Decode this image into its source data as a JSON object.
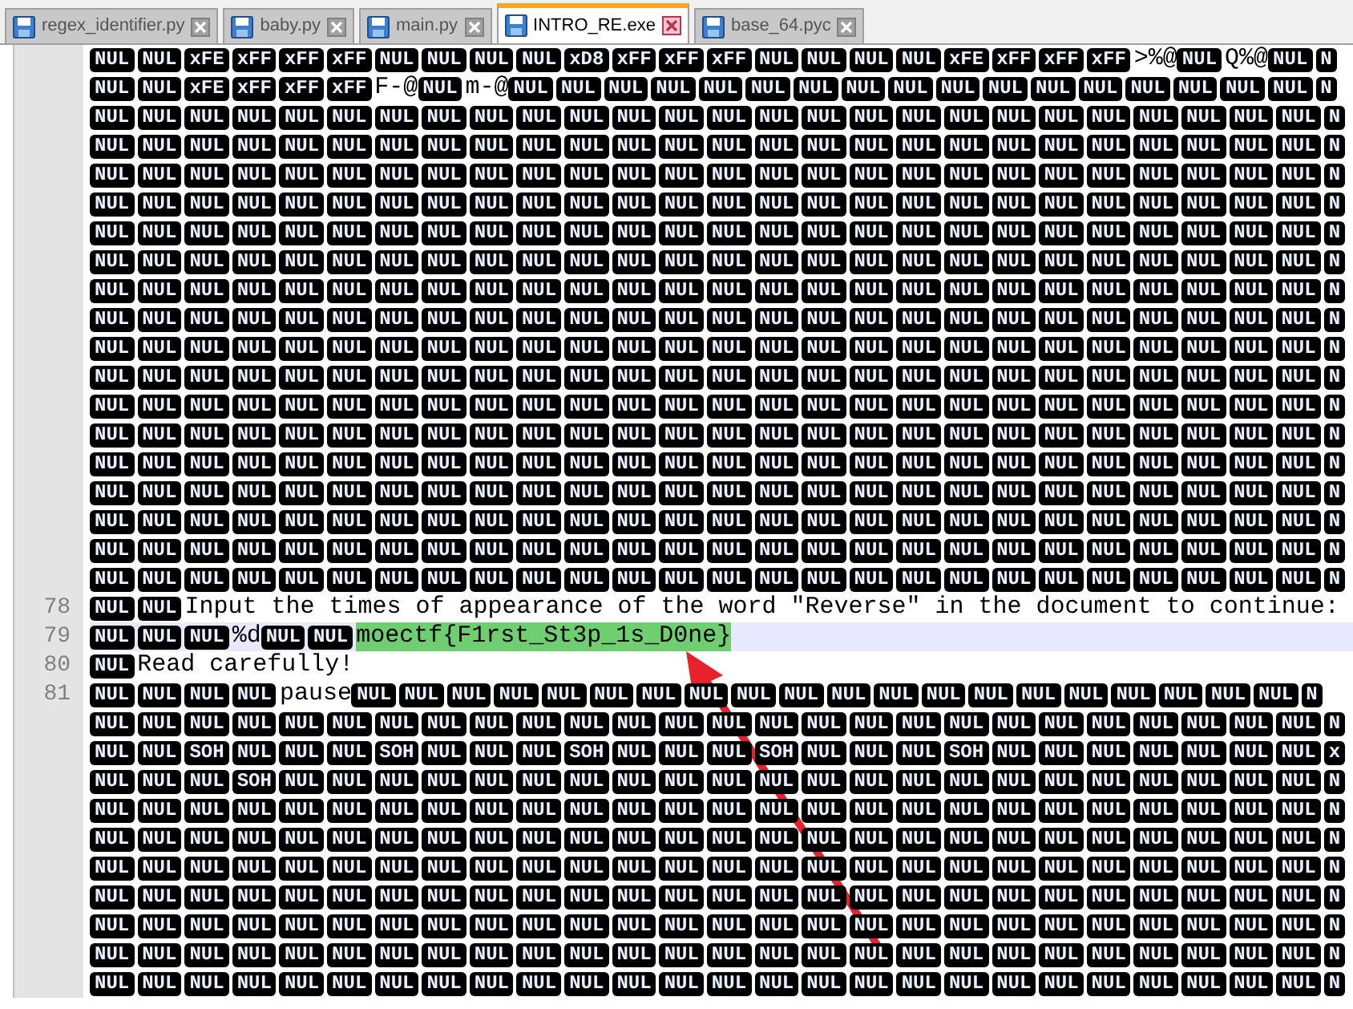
{
  "tabs": [
    {
      "label": "regex_identifier.py",
      "selected": false
    },
    {
      "label": "baby.py",
      "selected": false
    },
    {
      "label": "main.py",
      "selected": false
    },
    {
      "label": "INTRO_RE.exe",
      "selected": true
    },
    {
      "label": "base_64.pyc",
      "selected": false
    }
  ],
  "lines": [
    {
      "current": false,
      "runs": [
        {
          "kind": "ctrl",
          "texts": [
            "NUL",
            "NUL",
            "xFE",
            "xFF",
            "xFF",
            "xFF",
            "NUL",
            "NUL",
            "NUL",
            "NUL",
            "xD8",
            "xFF",
            "xFF",
            "xFF",
            "NUL",
            "NUL",
            "NUL",
            "NUL",
            "xFE",
            "xFF",
            "xFF",
            "xFF"
          ]
        },
        {
          "kind": "text",
          "text": ">%@",
          "highlighted": false
        },
        {
          "kind": "ctrl",
          "texts": [
            "NUL"
          ]
        },
        {
          "kind": "text",
          "text": "Q%@",
          "highlighted": false
        },
        {
          "kind": "ctrl",
          "texts": [
            "NUL",
            "N"
          ]
        }
      ]
    },
    {
      "current": false,
      "runs": [
        {
          "kind": "ctrl",
          "texts": [
            "NUL",
            "NUL",
            "xFE",
            "xFF",
            "xFF",
            "xFF"
          ]
        },
        {
          "kind": "text",
          "text": "F-@",
          "highlighted": false
        },
        {
          "kind": "ctrl",
          "texts": [
            "NUL"
          ]
        },
        {
          "kind": "text",
          "text": "m-@",
          "highlighted": false
        },
        {
          "kind": "ctrl",
          "texts": [
            "NUL",
            "NUL",
            "NUL",
            "NUL",
            "NUL",
            "NUL",
            "NUL",
            "NUL",
            "NUL",
            "NUL",
            "NUL",
            "NUL",
            "NUL",
            "NUL",
            "NUL",
            "NUL",
            "NUL",
            "N"
          ]
        }
      ]
    },
    {
      "current": false,
      "runs": [
        {
          "kind": "ctrl",
          "texts": [
            "NUL",
            "NUL",
            "NUL",
            "NUL",
            "NUL",
            "NUL",
            "NUL",
            "NUL",
            "NUL",
            "NUL",
            "NUL",
            "NUL",
            "NUL",
            "NUL",
            "NUL",
            "NUL",
            "NUL",
            "NUL",
            "NUL",
            "NUL",
            "NUL",
            "NUL",
            "NUL",
            "NUL",
            "NUL",
            "NUL",
            "N"
          ]
        }
      ]
    },
    {
      "current": false,
      "runs": [
        {
          "kind": "ctrl",
          "texts": [
            "NUL",
            "NUL",
            "NUL",
            "NUL",
            "NUL",
            "NUL",
            "NUL",
            "NUL",
            "NUL",
            "NUL",
            "NUL",
            "NUL",
            "NUL",
            "NUL",
            "NUL",
            "NUL",
            "NUL",
            "NUL",
            "NUL",
            "NUL",
            "NUL",
            "NUL",
            "NUL",
            "NUL",
            "NUL",
            "NUL",
            "N"
          ]
        }
      ]
    },
    {
      "current": false,
      "runs": [
        {
          "kind": "ctrl",
          "texts": [
            "NUL",
            "NUL",
            "NUL",
            "NUL",
            "NUL",
            "NUL",
            "NUL",
            "NUL",
            "NUL",
            "NUL",
            "NUL",
            "NUL",
            "NUL",
            "NUL",
            "NUL",
            "NUL",
            "NUL",
            "NUL",
            "NUL",
            "NUL",
            "NUL",
            "NUL",
            "NUL",
            "NUL",
            "NUL",
            "NUL",
            "N"
          ]
        }
      ]
    },
    {
      "current": false,
      "runs": [
        {
          "kind": "ctrl",
          "texts": [
            "NUL",
            "NUL",
            "NUL",
            "NUL",
            "NUL",
            "NUL",
            "NUL",
            "NUL",
            "NUL",
            "NUL",
            "NUL",
            "NUL",
            "NUL",
            "NUL",
            "NUL",
            "NUL",
            "NUL",
            "NUL",
            "NUL",
            "NUL",
            "NUL",
            "NUL",
            "NUL",
            "NUL",
            "NUL",
            "NUL",
            "N"
          ]
        }
      ]
    },
    {
      "current": false,
      "runs": [
        {
          "kind": "ctrl",
          "texts": [
            "NUL",
            "NUL",
            "NUL",
            "NUL",
            "NUL",
            "NUL",
            "NUL",
            "NUL",
            "NUL",
            "NUL",
            "NUL",
            "NUL",
            "NUL",
            "NUL",
            "NUL",
            "NUL",
            "NUL",
            "NUL",
            "NUL",
            "NUL",
            "NUL",
            "NUL",
            "NUL",
            "NUL",
            "NUL",
            "NUL",
            "N"
          ]
        }
      ]
    },
    {
      "current": false,
      "runs": [
        {
          "kind": "ctrl",
          "texts": [
            "NUL",
            "NUL",
            "NUL",
            "NUL",
            "NUL",
            "NUL",
            "NUL",
            "NUL",
            "NUL",
            "NUL",
            "NUL",
            "NUL",
            "NUL",
            "NUL",
            "NUL",
            "NUL",
            "NUL",
            "NUL",
            "NUL",
            "NUL",
            "NUL",
            "NUL",
            "NUL",
            "NUL",
            "NUL",
            "NUL",
            "N"
          ]
        }
      ]
    },
    {
      "current": false,
      "runs": [
        {
          "kind": "ctrl",
          "texts": [
            "NUL",
            "NUL",
            "NUL",
            "NUL",
            "NUL",
            "NUL",
            "NUL",
            "NUL",
            "NUL",
            "NUL",
            "NUL",
            "NUL",
            "NUL",
            "NUL",
            "NUL",
            "NUL",
            "NUL",
            "NUL",
            "NUL",
            "NUL",
            "NUL",
            "NUL",
            "NUL",
            "NUL",
            "NUL",
            "NUL",
            "N"
          ]
        }
      ]
    },
    {
      "current": false,
      "runs": [
        {
          "kind": "ctrl",
          "texts": [
            "NUL",
            "NUL",
            "NUL",
            "NUL",
            "NUL",
            "NUL",
            "NUL",
            "NUL",
            "NUL",
            "NUL",
            "NUL",
            "NUL",
            "NUL",
            "NUL",
            "NUL",
            "NUL",
            "NUL",
            "NUL",
            "NUL",
            "NUL",
            "NUL",
            "NUL",
            "NUL",
            "NUL",
            "NUL",
            "NUL",
            "N"
          ]
        }
      ]
    },
    {
      "current": false,
      "runs": [
        {
          "kind": "ctrl",
          "texts": [
            "NUL",
            "NUL",
            "NUL",
            "NUL",
            "NUL",
            "NUL",
            "NUL",
            "NUL",
            "NUL",
            "NUL",
            "NUL",
            "NUL",
            "NUL",
            "NUL",
            "NUL",
            "NUL",
            "NUL",
            "NUL",
            "NUL",
            "NUL",
            "NUL",
            "NUL",
            "NUL",
            "NUL",
            "NUL",
            "NUL",
            "N"
          ]
        }
      ]
    },
    {
      "current": false,
      "runs": [
        {
          "kind": "ctrl",
          "texts": [
            "NUL",
            "NUL",
            "NUL",
            "NUL",
            "NUL",
            "NUL",
            "NUL",
            "NUL",
            "NUL",
            "NUL",
            "NUL",
            "NUL",
            "NUL",
            "NUL",
            "NUL",
            "NUL",
            "NUL",
            "NUL",
            "NUL",
            "NUL",
            "NUL",
            "NUL",
            "NUL",
            "NUL",
            "NUL",
            "NUL",
            "N"
          ]
        }
      ]
    },
    {
      "current": false,
      "runs": [
        {
          "kind": "ctrl",
          "texts": [
            "NUL",
            "NUL",
            "NUL",
            "NUL",
            "NUL",
            "NUL",
            "NUL",
            "NUL",
            "NUL",
            "NUL",
            "NUL",
            "NUL",
            "NUL",
            "NUL",
            "NUL",
            "NUL",
            "NUL",
            "NUL",
            "NUL",
            "NUL",
            "NUL",
            "NUL",
            "NUL",
            "NUL",
            "NUL",
            "NUL",
            "N"
          ]
        }
      ]
    },
    {
      "current": false,
      "runs": [
        {
          "kind": "ctrl",
          "texts": [
            "NUL",
            "NUL",
            "NUL",
            "NUL",
            "NUL",
            "NUL",
            "NUL",
            "NUL",
            "NUL",
            "NUL",
            "NUL",
            "NUL",
            "NUL",
            "NUL",
            "NUL",
            "NUL",
            "NUL",
            "NUL",
            "NUL",
            "NUL",
            "NUL",
            "NUL",
            "NUL",
            "NUL",
            "NUL",
            "NUL",
            "N"
          ]
        }
      ]
    },
    {
      "current": false,
      "runs": [
        {
          "kind": "ctrl",
          "texts": [
            "NUL",
            "NUL",
            "NUL",
            "NUL",
            "NUL",
            "NUL",
            "NUL",
            "NUL",
            "NUL",
            "NUL",
            "NUL",
            "NUL",
            "NUL",
            "NUL",
            "NUL",
            "NUL",
            "NUL",
            "NUL",
            "NUL",
            "NUL",
            "NUL",
            "NUL",
            "NUL",
            "NUL",
            "NUL",
            "NUL",
            "N"
          ]
        }
      ]
    },
    {
      "current": false,
      "runs": [
        {
          "kind": "ctrl",
          "texts": [
            "NUL",
            "NUL",
            "NUL",
            "NUL",
            "NUL",
            "NUL",
            "NUL",
            "NUL",
            "NUL",
            "NUL",
            "NUL",
            "NUL",
            "NUL",
            "NUL",
            "NUL",
            "NUL",
            "NUL",
            "NUL",
            "NUL",
            "NUL",
            "NUL",
            "NUL",
            "NUL",
            "NUL",
            "NUL",
            "NUL",
            "N"
          ]
        }
      ]
    },
    {
      "current": false,
      "runs": [
        {
          "kind": "ctrl",
          "texts": [
            "NUL",
            "NUL",
            "NUL",
            "NUL",
            "NUL",
            "NUL",
            "NUL",
            "NUL",
            "NUL",
            "NUL",
            "NUL",
            "NUL",
            "NUL",
            "NUL",
            "NUL",
            "NUL",
            "NUL",
            "NUL",
            "NUL",
            "NUL",
            "NUL",
            "NUL",
            "NUL",
            "NUL",
            "NUL",
            "NUL",
            "N"
          ]
        }
      ]
    },
    {
      "current": false,
      "runs": [
        {
          "kind": "ctrl",
          "texts": [
            "NUL",
            "NUL",
            "NUL",
            "NUL",
            "NUL",
            "NUL",
            "NUL",
            "NUL",
            "NUL",
            "NUL",
            "NUL",
            "NUL",
            "NUL",
            "NUL",
            "NUL",
            "NUL",
            "NUL",
            "NUL",
            "NUL",
            "NUL",
            "NUL",
            "NUL",
            "NUL",
            "NUL",
            "NUL",
            "NUL",
            "N"
          ]
        }
      ]
    },
    {
      "current": false,
      "runs": [
        {
          "kind": "ctrl",
          "texts": [
            "NUL",
            "NUL",
            "NUL",
            "NUL",
            "NUL",
            "NUL",
            "NUL",
            "NUL",
            "NUL",
            "NUL",
            "NUL",
            "NUL",
            "NUL",
            "NUL",
            "NUL",
            "NUL",
            "NUL",
            "NUL",
            "NUL",
            "NUL",
            "NUL",
            "NUL",
            "NUL",
            "NUL",
            "NUL",
            "NUL",
            "N"
          ]
        }
      ]
    },
    {
      "number": "78",
      "current": false,
      "runs": [
        {
          "kind": "ctrl",
          "texts": [
            "NUL",
            "NUL"
          ]
        },
        {
          "kind": "text",
          "text": "Input the times of appearance of the word \"Reverse\" in the document to continue:",
          "highlighted": false
        }
      ]
    },
    {
      "number": "79",
      "current": true,
      "runs": [
        {
          "kind": "ctrl",
          "texts": [
            "NUL",
            "NUL",
            "NUL"
          ]
        },
        {
          "kind": "text",
          "text": "%d",
          "highlighted": false
        },
        {
          "kind": "ctrl",
          "texts": [
            "NUL",
            "NUL"
          ]
        },
        {
          "kind": "text",
          "text": "moectf{F1rst_St3p_1s_D0ne}",
          "highlighted": true
        }
      ]
    },
    {
      "number": "80",
      "current": false,
      "runs": [
        {
          "kind": "ctrl",
          "texts": [
            "NUL"
          ]
        },
        {
          "kind": "text",
          "text": "Read carefully!",
          "highlighted": false
        }
      ]
    },
    {
      "number": "81",
      "current": false,
      "runs": [
        {
          "kind": "ctrl",
          "texts": [
            "NUL",
            "NUL",
            "NUL",
            "NUL"
          ]
        },
        {
          "kind": "text",
          "text": "pause",
          "highlighted": false
        },
        {
          "kind": "ctrl",
          "texts": [
            "NUL",
            "NUL",
            "NUL",
            "NUL",
            "NUL",
            "NUL",
            "NUL",
            "NUL",
            "NUL",
            "NUL",
            "NUL",
            "NUL",
            "NUL",
            "NUL",
            "NUL",
            "NUL",
            "NUL",
            "NUL",
            "NUL",
            "NUL",
            "N"
          ]
        }
      ]
    },
    {
      "current": false,
      "runs": [
        {
          "kind": "ctrl",
          "texts": [
            "NUL",
            "NUL",
            "NUL",
            "NUL",
            "NUL",
            "NUL",
            "NUL",
            "NUL",
            "NUL",
            "NUL",
            "NUL",
            "NUL",
            "NUL",
            "NUL",
            "NUL",
            "NUL",
            "NUL",
            "NUL",
            "NUL",
            "NUL",
            "NUL",
            "NUL",
            "NUL",
            "NUL",
            "NUL",
            "NUL",
            "N"
          ]
        }
      ]
    },
    {
      "current": false,
      "runs": [
        {
          "kind": "ctrl",
          "texts": [
            "NUL",
            "NUL",
            "SOH",
            "NUL",
            "NUL",
            "NUL",
            "SOH",
            "NUL",
            "NUL",
            "NUL",
            "SOH",
            "NUL",
            "NUL",
            "NUL",
            "SOH",
            "NUL",
            "NUL",
            "NUL",
            "SOH",
            "NUL",
            "NUL",
            "NUL",
            "NUL",
            "NUL",
            "NUL",
            "NUL",
            "x"
          ]
        }
      ]
    },
    {
      "current": false,
      "runs": [
        {
          "kind": "ctrl",
          "texts": [
            "NUL",
            "NUL",
            "NUL",
            "SOH",
            "NUL",
            "NUL",
            "NUL",
            "NUL",
            "NUL",
            "NUL",
            "NUL",
            "NUL",
            "NUL",
            "NUL",
            "NUL",
            "NUL",
            "NUL",
            "NUL",
            "NUL",
            "NUL",
            "NUL",
            "NUL",
            "NUL",
            "NUL",
            "NUL",
            "NUL",
            "N"
          ]
        }
      ]
    },
    {
      "current": false,
      "runs": [
        {
          "kind": "ctrl",
          "texts": [
            "NUL",
            "NUL",
            "NUL",
            "NUL",
            "NUL",
            "NUL",
            "NUL",
            "NUL",
            "NUL",
            "NUL",
            "NUL",
            "NUL",
            "NUL",
            "NUL",
            "NUL",
            "NUL",
            "NUL",
            "NUL",
            "NUL",
            "NUL",
            "NUL",
            "NUL",
            "NUL",
            "NUL",
            "NUL",
            "NUL",
            "N"
          ]
        }
      ]
    },
    {
      "current": false,
      "runs": [
        {
          "kind": "ctrl",
          "texts": [
            "NUL",
            "NUL",
            "NUL",
            "NUL",
            "NUL",
            "NUL",
            "NUL",
            "NUL",
            "NUL",
            "NUL",
            "NUL",
            "NUL",
            "NUL",
            "NUL",
            "NUL",
            "NUL",
            "NUL",
            "NUL",
            "NUL",
            "NUL",
            "NUL",
            "NUL",
            "NUL",
            "NUL",
            "NUL",
            "NUL",
            "N"
          ]
        }
      ]
    },
    {
      "current": false,
      "runs": [
        {
          "kind": "ctrl",
          "texts": [
            "NUL",
            "NUL",
            "NUL",
            "NUL",
            "NUL",
            "NUL",
            "NUL",
            "NUL",
            "NUL",
            "NUL",
            "NUL",
            "NUL",
            "NUL",
            "NUL",
            "NUL",
            "NUL",
            "NUL",
            "NUL",
            "NUL",
            "NUL",
            "NUL",
            "NUL",
            "NUL",
            "NUL",
            "NUL",
            "NUL",
            "N"
          ]
        }
      ]
    },
    {
      "current": false,
      "runs": [
        {
          "kind": "ctrl",
          "texts": [
            "NUL",
            "NUL",
            "NUL",
            "NUL",
            "NUL",
            "NUL",
            "NUL",
            "NUL",
            "NUL",
            "NUL",
            "NUL",
            "NUL",
            "NUL",
            "NUL",
            "NUL",
            "NUL",
            "NUL",
            "NUL",
            "NUL",
            "NUL",
            "NUL",
            "NUL",
            "NUL",
            "NUL",
            "NUL",
            "NUL",
            "N"
          ]
        }
      ]
    },
    {
      "current": false,
      "runs": [
        {
          "kind": "ctrl",
          "texts": [
            "NUL",
            "NUL",
            "NUL",
            "NUL",
            "NUL",
            "NUL",
            "NUL",
            "NUL",
            "NUL",
            "NUL",
            "NUL",
            "NUL",
            "NUL",
            "NUL",
            "NUL",
            "NUL",
            "NUL",
            "NUL",
            "NUL",
            "NUL",
            "NUL",
            "NUL",
            "NUL",
            "NUL",
            "NUL",
            "NUL",
            "N"
          ]
        }
      ]
    },
    {
      "current": false,
      "runs": [
        {
          "kind": "ctrl",
          "texts": [
            "NUL",
            "NUL",
            "NUL",
            "NUL",
            "NUL",
            "NUL",
            "NUL",
            "NUL",
            "NUL",
            "NUL",
            "NUL",
            "NUL",
            "NUL",
            "NUL",
            "NUL",
            "NUL",
            "NUL",
            "NUL",
            "NUL",
            "NUL",
            "NUL",
            "NUL",
            "NUL",
            "NUL",
            "NUL",
            "NUL",
            "N"
          ]
        }
      ]
    },
    {
      "current": false,
      "runs": [
        {
          "kind": "ctrl",
          "texts": [
            "NUL",
            "NUL",
            "NUL",
            "NUL",
            "NUL",
            "NUL",
            "NUL",
            "NUL",
            "NUL",
            "NUL",
            "NUL",
            "NUL",
            "NUL",
            "NUL",
            "NUL",
            "NUL",
            "NUL",
            "NUL",
            "NUL",
            "NUL",
            "NUL",
            "NUL",
            "NUL",
            "NUL",
            "NUL",
            "NUL",
            "N"
          ]
        }
      ]
    }
  ]
}
